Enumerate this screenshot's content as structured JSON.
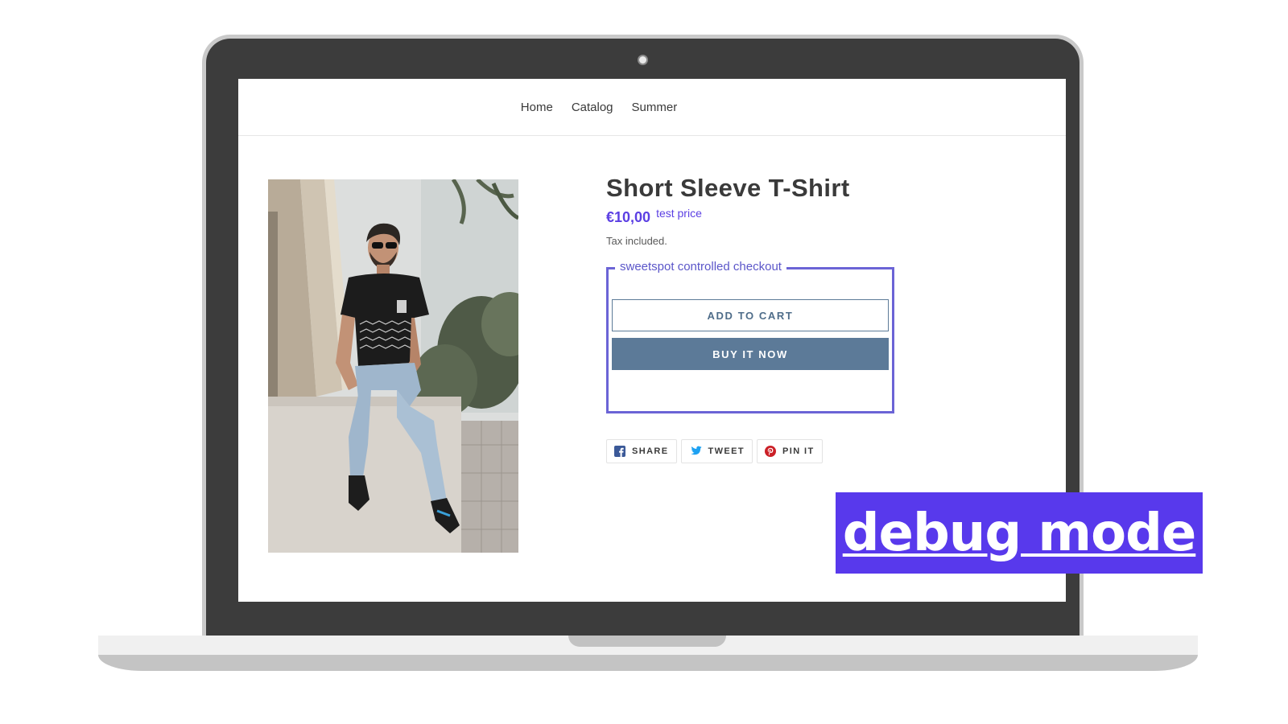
{
  "nav": {
    "items": [
      {
        "label": "Home"
      },
      {
        "label": "Catalog"
      },
      {
        "label": "Summer"
      }
    ]
  },
  "product": {
    "title": "Short Sleeve T-Shirt",
    "price": "€10,00",
    "price_note": "test price",
    "tax_note": "Tax included.",
    "image_alt_icon": "man-in-t-shirt-photo"
  },
  "checkout": {
    "legend": "sweetspot controlled checkout",
    "add_to_cart": "ADD TO CART",
    "buy_now": "BUY IT NOW"
  },
  "share": [
    {
      "label": "SHARE",
      "icon": "facebook-icon",
      "color": "#3b5998"
    },
    {
      "label": "TWEET",
      "icon": "twitter-icon",
      "color": "#1da1f2"
    },
    {
      "label": "PIN IT",
      "icon": "pinterest-icon",
      "color": "#cb2027"
    }
  ],
  "banner": {
    "text": "debug mode",
    "color": "#5839ec"
  },
  "colors": {
    "accent": "#5b3fe3",
    "checkout_border": "#6b64d6",
    "button": "#5c7a98"
  }
}
